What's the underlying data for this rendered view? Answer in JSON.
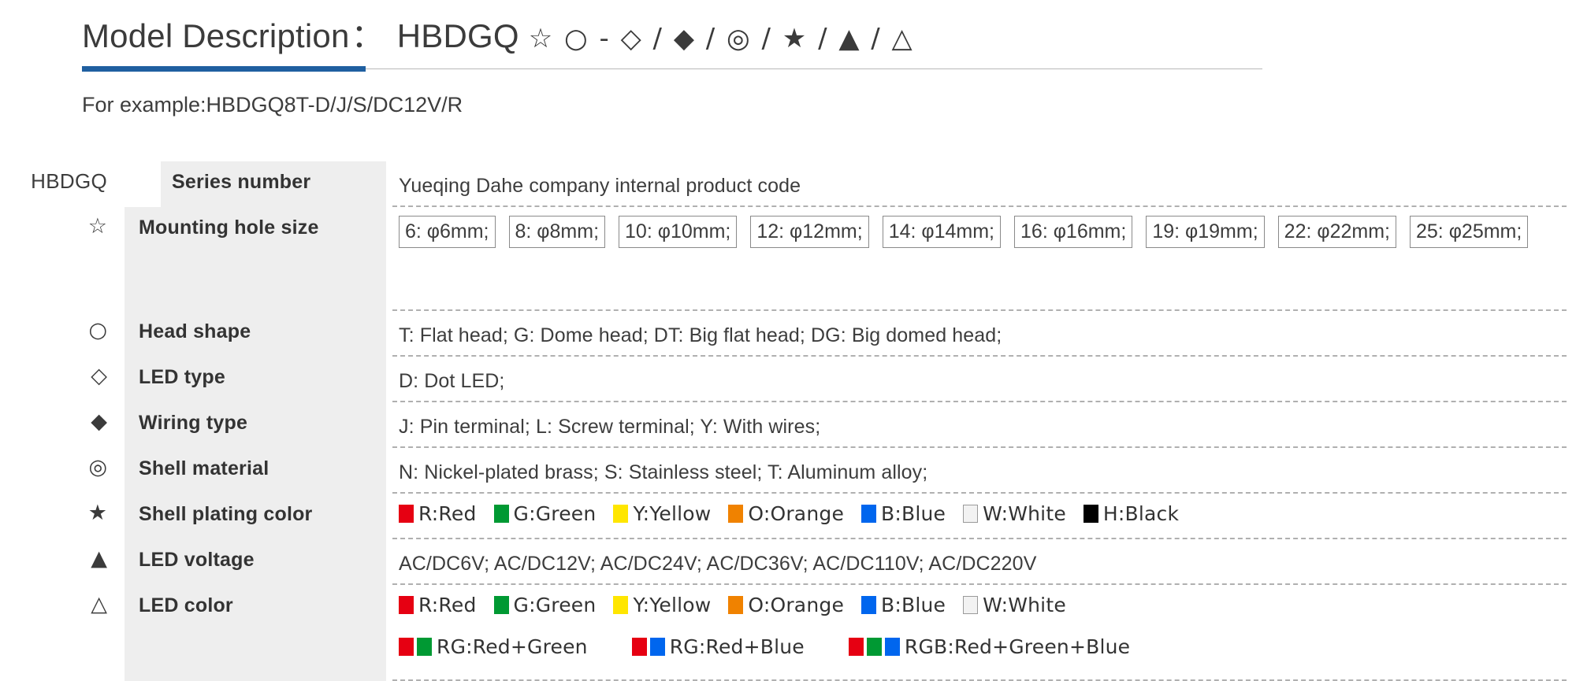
{
  "header": {
    "title_main": "Model Description",
    "title_colon": "：",
    "title_code": "HBDGQ",
    "title_symbols": "☆ ○ - ◇ / ◆ / ◎ / ★ / ▲ / △",
    "accent_color": "#1f5fa0",
    "example": "For example:HBDGQ8T-D/J/S/DC12V/R"
  },
  "table": {
    "rows": [
      {
        "symbol": "HBDGQ",
        "symbol_kind": "text",
        "label": "Series number",
        "value_type": "text",
        "value": "Yueqing Dahe company internal product code"
      },
      {
        "symbol": "☆",
        "symbol_kind": "glyph",
        "label": "Mounting hole size",
        "value_type": "chips",
        "chips": [
          "6: φ6mm;",
          "8: φ8mm;",
          "10: φ10mm;",
          "12: φ12mm;",
          "14: φ14mm;",
          "16: φ16mm;",
          "19: φ19mm;",
          "22: φ22mm;",
          "25: φ25mm;"
        ]
      },
      {
        "symbol": "○",
        "symbol_kind": "glyph",
        "label": "Head  shape",
        "value_type": "text",
        "value": "T: Flat head;   G: Dome head;   DT: Big flat head;   DG: Big domed head;"
      },
      {
        "symbol": "◇",
        "symbol_kind": "glyph",
        "label": "LED type",
        "value_type": "text",
        "value": "D: Dot LED;"
      },
      {
        "symbol": "◆",
        "symbol_kind": "glyph",
        "label": "Wiring type",
        "value_type": "text",
        "value": "J: Pin terminal;   L: Screw terminal;   Y: With wires;"
      },
      {
        "symbol": "◎",
        "symbol_kind": "glyph",
        "label": "Shell material",
        "value_type": "text",
        "value": "N: Nickel-plated brass;   S: Stainless steel;   T: Aluminum alloy;"
      },
      {
        "symbol": "★",
        "symbol_kind": "glyph",
        "label": "Shell plating color",
        "value_type": "swatches",
        "swatches": [
          {
            "label": "R:Red",
            "colors": [
              "#e60012"
            ]
          },
          {
            "label": "G:Green",
            "colors": [
              "#009933"
            ]
          },
          {
            "label": "Y:Yellow",
            "colors": [
              "#ffe600"
            ]
          },
          {
            "label": "O:Orange",
            "colors": [
              "#f08200"
            ]
          },
          {
            "label": "B:Blue",
            "colors": [
              "#0066ee"
            ]
          },
          {
            "label": "W:White",
            "colors": [
              "#f2f2f2"
            ]
          },
          {
            "label": "H:Black",
            "colors": [
              "#000000"
            ]
          }
        ]
      },
      {
        "symbol": "▲",
        "symbol_kind": "glyph",
        "label": "LED voltage",
        "value_type": "text",
        "value": "AC/DC6V;   AC/DC12V;   AC/DC24V;   AC/DC36V;   AC/DC110V;   AC/DC220V"
      },
      {
        "symbol": "△",
        "symbol_kind": "glyph",
        "label": "LED color",
        "value_type": "swatches2",
        "swatches": [
          {
            "label": "R:Red",
            "colors": [
              "#e60012"
            ]
          },
          {
            "label": "G:Green",
            "colors": [
              "#009933"
            ]
          },
          {
            "label": "Y:Yellow",
            "colors": [
              "#ffe600"
            ]
          },
          {
            "label": "O:Orange",
            "colors": [
              "#f08200"
            ]
          },
          {
            "label": "B:Blue",
            "colors": [
              "#0066ee"
            ]
          },
          {
            "label": "W:White",
            "colors": [
              "#f2f2f2"
            ]
          }
        ],
        "swatches_line2": [
          {
            "label": "RG:Red+Green",
            "colors": [
              "#e60012",
              "#009933"
            ]
          },
          {
            "label": "RG:Red+Blue",
            "colors": [
              "#e60012",
              "#0066ee"
            ]
          },
          {
            "label": "RGB:Red+Green+Blue",
            "colors": [
              "#e60012",
              "#009933",
              "#0066ee"
            ]
          }
        ]
      }
    ]
  }
}
